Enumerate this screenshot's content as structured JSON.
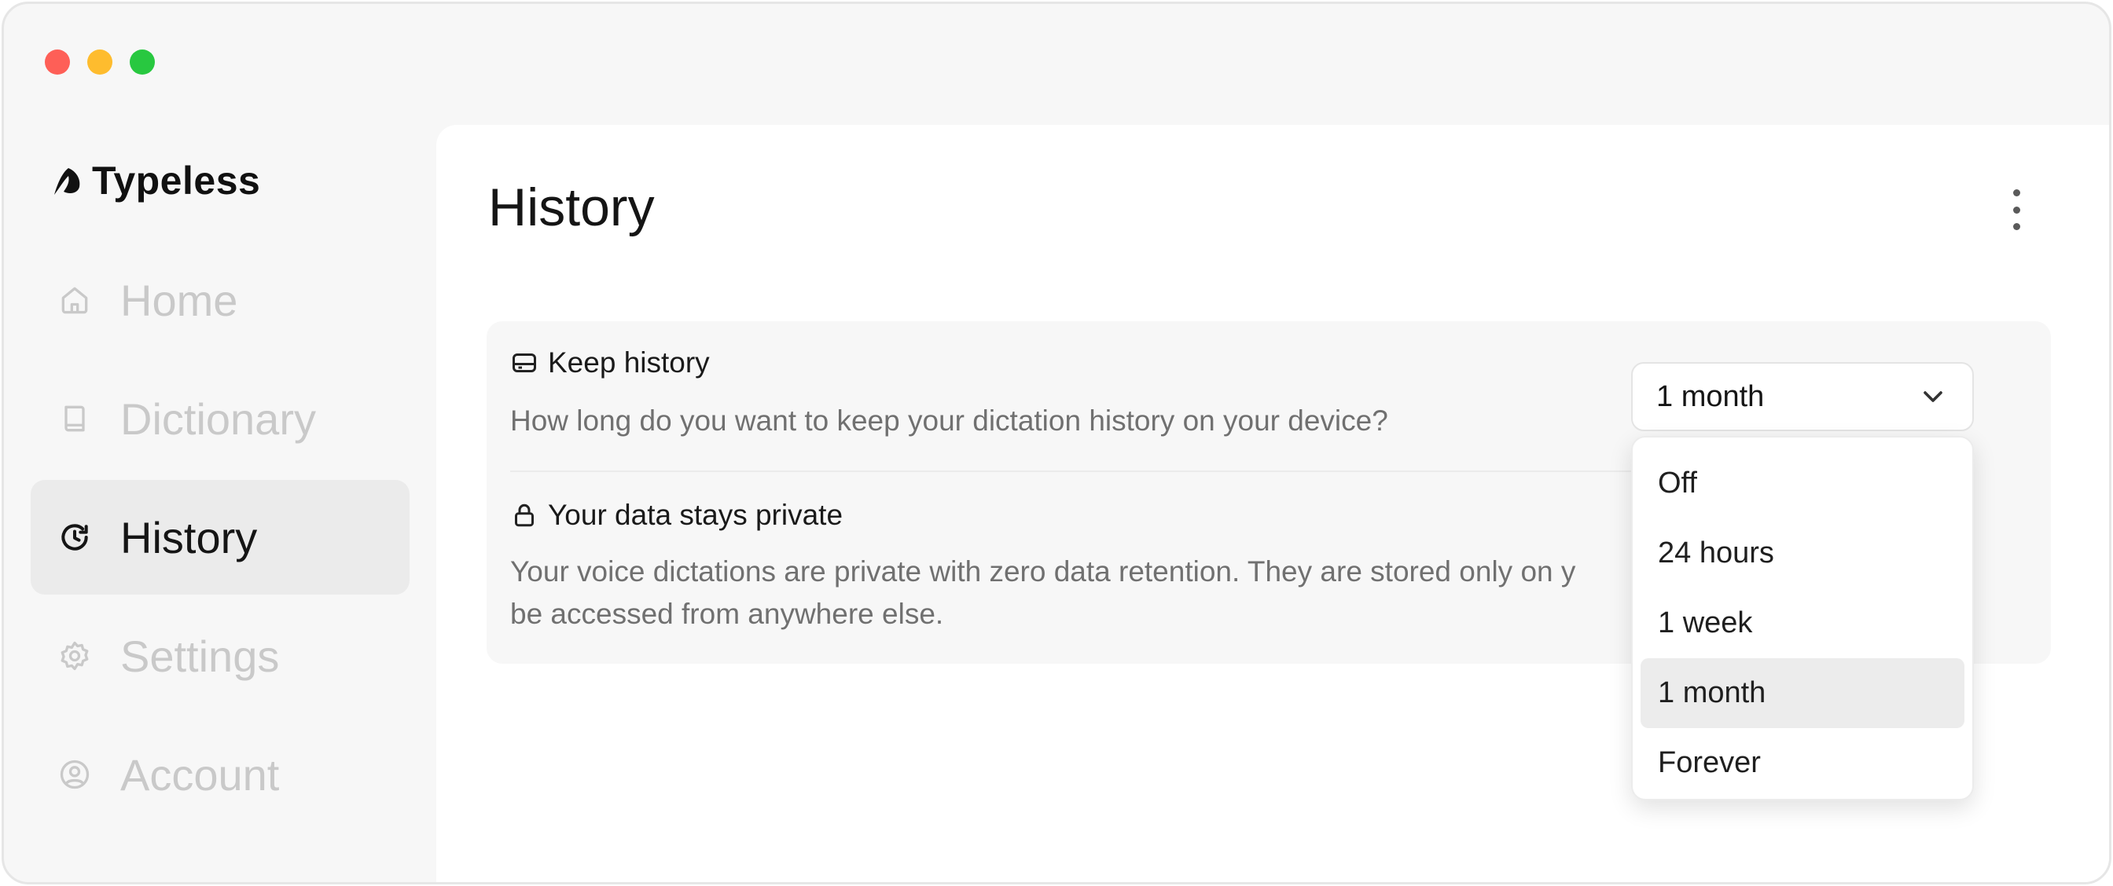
{
  "app": {
    "name": "Typeless"
  },
  "sidebar": {
    "items": [
      {
        "label": "Home",
        "icon": "home-icon",
        "active": false
      },
      {
        "label": "Dictionary",
        "icon": "book-icon",
        "active": false
      },
      {
        "label": "History",
        "icon": "history-icon",
        "active": true
      },
      {
        "label": "Settings",
        "icon": "gear-icon",
        "active": false
      },
      {
        "label": "Account",
        "icon": "user-circle-icon",
        "active": false
      }
    ]
  },
  "main": {
    "title": "History",
    "keep_history": {
      "title": "Keep history",
      "description": "How long do you want to keep your dictation history on your device?",
      "selected": "1 month",
      "options": [
        "Off",
        "24 hours",
        "1 week",
        "1 month",
        "Forever"
      ]
    },
    "privacy": {
      "title": "Your data stays private",
      "description_line1": "Your voice dictations are private with zero data retention. They are stored only on y",
      "description_line2": "be accessed from anywhere else."
    }
  },
  "colors": {
    "window_bg": "#f7f7f7",
    "active_nav_bg": "#ebebeb",
    "inactive_nav_text": "#c9c9c9",
    "traffic_red": "#fe5f57",
    "traffic_yellow": "#febc2e",
    "traffic_green": "#28c840"
  }
}
